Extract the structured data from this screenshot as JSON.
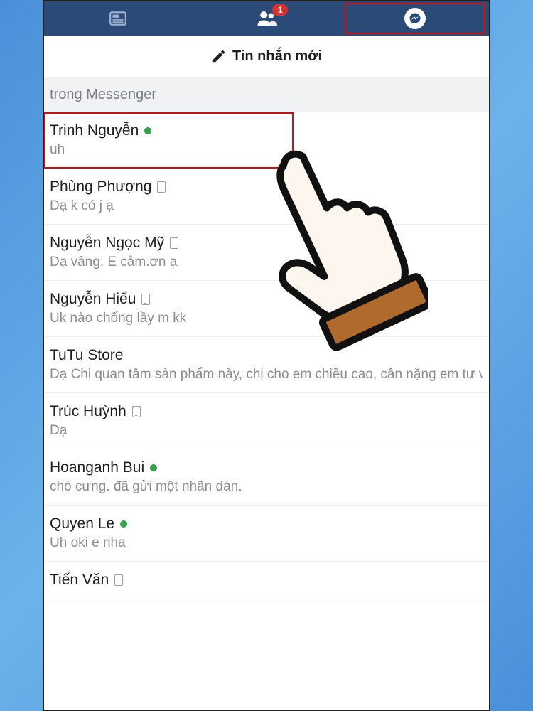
{
  "topbar": {
    "friends_badge": "1"
  },
  "new_message_label": "Tin nhắn mới",
  "search_placeholder": "trong Messenger",
  "conversations": [
    {
      "name": "Trinh Nguyễn",
      "status": "online",
      "preview": "uh",
      "highlight": true
    },
    {
      "name": "Phùng Phượng",
      "status": "mobile",
      "preview": "Dạ k có j ạ"
    },
    {
      "name": "Nguyễn Ngọc Mỹ",
      "status": "mobile",
      "preview": "Dạ vâng. E cảm.ơn ạ"
    },
    {
      "name": "Nguyễn Hiếu",
      "status": "mobile",
      "preview": "Uk nào chống lầy m kk"
    },
    {
      "name": "TuTu Store",
      "status": "",
      "preview": "Dạ Chị quan tâm sản phẩm này, chị cho em chiều cao, cân nặng em tư v"
    },
    {
      "name": "Trúc Huỳnh",
      "status": "mobile",
      "preview": "Dạ"
    },
    {
      "name": "Hoanganh Bui",
      "status": "online",
      "preview": "chó cưng. đã gửi một nhãn dán."
    },
    {
      "name": "Quyen Le",
      "status": "online",
      "preview": "Uh oki e nha"
    },
    {
      "name": "Tiến Văn",
      "status": "mobile",
      "preview": ""
    }
  ]
}
